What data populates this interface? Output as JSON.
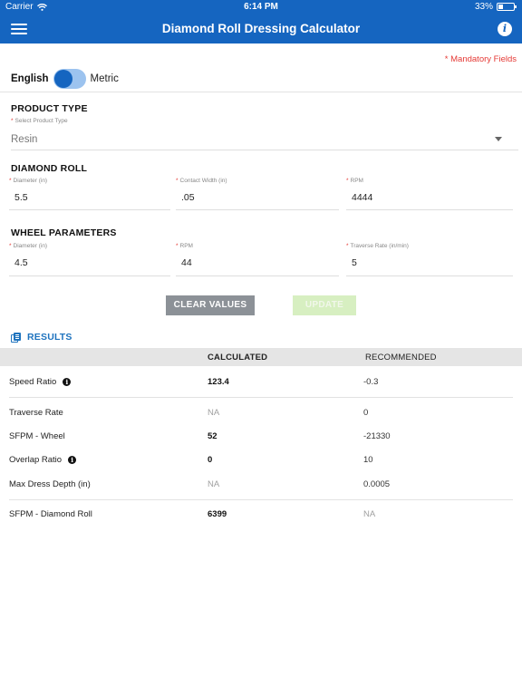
{
  "status_bar": {
    "carrier": "Carrier",
    "time": "6:14 PM",
    "battery": "33%",
    "battery_level": 0.33
  },
  "nav": {
    "title": "Diamond Roll Dressing Calculator"
  },
  "mandatory_note": "* Mandatory Fields",
  "units": {
    "english": "English",
    "metric": "Metric",
    "selected": "English"
  },
  "product_type": {
    "title": "PRODUCT TYPE",
    "select_label": "Select Product Type",
    "value": "Resin"
  },
  "diamond_roll": {
    "title": "DIAMOND ROLL",
    "fields": [
      {
        "label": "Diameter (in)",
        "value": "5.5"
      },
      {
        "label": "Contact Width (in)",
        "value": ".05"
      },
      {
        "label": "RPM",
        "value": "4444"
      }
    ]
  },
  "wheel_parameters": {
    "title": "WHEEL PARAMETERS",
    "fields": [
      {
        "label": "Diameter (in)",
        "value": "4.5"
      },
      {
        "label": "RPM",
        "value": "44"
      },
      {
        "label": "Traverse Rate (in/min)",
        "value": "5"
      }
    ]
  },
  "buttons": {
    "clear": "CLEAR VALUES",
    "update": "UPDATE"
  },
  "results": {
    "title": "RESULTS",
    "columns": {
      "calculated": "CALCULATED",
      "recommended": "RECOMMENDED"
    },
    "rows": [
      {
        "label": "Speed Ratio",
        "calculated": "123.4",
        "recommended": "-0.3",
        "info": true
      },
      {
        "label": "Traverse Rate",
        "calculated": "NA",
        "recommended": "0",
        "info": false
      },
      {
        "label": "SFPM - Wheel",
        "calculated": "52",
        "recommended": "-21330",
        "info": false
      },
      {
        "label": "Overlap Ratio",
        "calculated": "0",
        "recommended": "10",
        "info": true
      },
      {
        "label": "Max Dress Depth (in)",
        "calculated": "NA",
        "recommended": "0.0005",
        "info": false
      },
      {
        "label": "SFPM - Diamond Roll",
        "calculated": "6399",
        "recommended": "NA",
        "info": false
      }
    ]
  },
  "icons": {
    "menu": "hamburger-menu-icon",
    "info": "info-icon",
    "dropdown": "chevron-down-icon",
    "results": "results-document-icon",
    "wifi": "wifi-icon",
    "battery": "battery-icon"
  },
  "colors": {
    "primary": "#1565c0",
    "mandatory": "#e53935",
    "results_accent": "#1e73be",
    "clear_button": "#8c9197",
    "update_button_disabled": "#d7efc1"
  }
}
